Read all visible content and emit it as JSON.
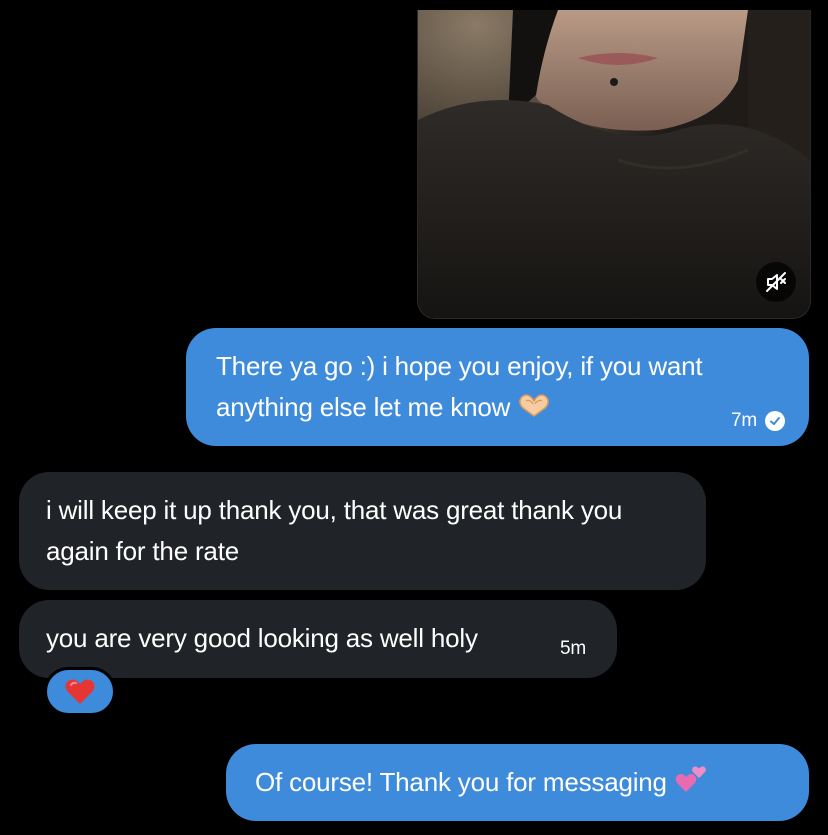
{
  "conversation": {
    "media": {
      "mute_icon": "speaker-muted-icon"
    },
    "messages": [
      {
        "direction": "outgoing",
        "text": "There ya go :) i hope you enjoy, if you want anything else let me know",
        "emoji": "heart-hands-emoji",
        "time": "7m",
        "status_icon": "read-check-icon"
      },
      {
        "direction": "incoming",
        "text": "i will keep it up thank you, that was great thank you again for the rate"
      },
      {
        "direction": "incoming",
        "text": "you are very good looking as well holy",
        "time": "5m",
        "reaction": "red-heart-emoji"
      },
      {
        "direction": "outgoing",
        "text": "Of course! Thank you for messaging",
        "emoji": "two-hearts-emoji"
      }
    ]
  },
  "colors": {
    "background": "#000000",
    "outgoing_bubble": "#3e8bdb",
    "incoming_bubble": "#202327",
    "text": "#ffffff"
  }
}
